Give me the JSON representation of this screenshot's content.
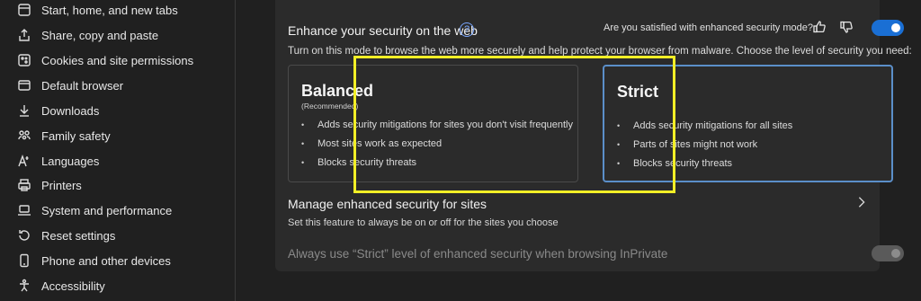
{
  "sidebar": {
    "items": [
      {
        "label": "Start, home, and new tabs",
        "icon": "home-tabs-icon"
      },
      {
        "label": "Share, copy and paste",
        "icon": "share-icon"
      },
      {
        "label": "Cookies and site permissions",
        "icon": "cookies-icon"
      },
      {
        "label": "Default browser",
        "icon": "browser-icon"
      },
      {
        "label": "Downloads",
        "icon": "download-icon"
      },
      {
        "label": "Family safety",
        "icon": "family-icon"
      },
      {
        "label": "Languages",
        "icon": "languages-icon"
      },
      {
        "label": "Printers",
        "icon": "printer-icon"
      },
      {
        "label": "System and performance",
        "icon": "laptop-icon"
      },
      {
        "label": "Reset settings",
        "icon": "reset-icon"
      },
      {
        "label": "Phone and other devices",
        "icon": "phone-icon"
      },
      {
        "label": "Accessibility",
        "icon": "accessibility-icon"
      }
    ]
  },
  "security": {
    "title": "Enhance your security on the web",
    "help": "?",
    "feedback_question": "Are you satisfied with enhanced security mode?",
    "toggle_on": true,
    "description": "Turn on this mode to browse the web more securely and help protect your browser from malware. Choose the level of security you need:",
    "modes": [
      {
        "name": "Balanced",
        "subtitle": "(Recommended)",
        "bullets": [
          "Adds security mitigations for sites you don't visit frequently",
          "Most sites work as expected",
          "Blocks security threats"
        ]
      },
      {
        "name": "Strict",
        "subtitle": "",
        "bullets": [
          "Adds security mitigations for all sites",
          "Parts of sites might not work",
          "Blocks security threats"
        ]
      }
    ],
    "selected_mode": "Strict",
    "bullet_char": "•",
    "manage": {
      "title": "Manage enhanced security for sites",
      "description": "Set this feature to always be on or off for the sites you choose"
    },
    "inprivate_label": "Always use “Strict” level of enhanced security when browsing InPrivate",
    "inprivate_toggle_on": true,
    "inprivate_disabled": true
  },
  "colors": {
    "accent": "#1a6fd4",
    "highlight": "#f2ef26",
    "selected_border": "#5b8fc9",
    "disabled_toggle": "#5a5a5a"
  }
}
